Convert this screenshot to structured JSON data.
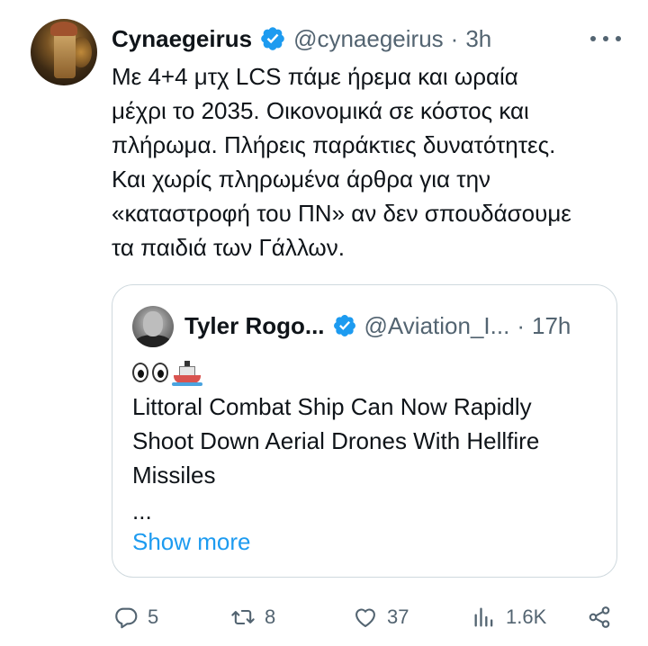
{
  "author": {
    "name": "Cynaegeirus",
    "handle": "@cynaegeirus",
    "separator": "·",
    "time": "3h",
    "verified_color": "#1d9bf0"
  },
  "tweet": {
    "lines": [
      "Με 4+4 μτχ LCS πάμε ήρεμα και ωραία",
      "μέχρι το 2035. Οικονομικά σε κόστος και",
      "πλήρωμα. Πλήρεις παράκτιες δυνατότητες.",
      "Και χωρίς πληρωμένα άρθρα για την",
      "«καταστροφή του ΠΝ» αν δεν σπουδάσουμε",
      "τα παιδιά των Γάλλων."
    ]
  },
  "quoted": {
    "name": "Tyler Rogo...",
    "handle": "@Aviation_I...",
    "separator": "·",
    "time": "17h",
    "emoji_icons": [
      "eyes-emoji",
      "ship-emoji"
    ],
    "lines": [
      "Littoral Combat Ship Can Now Rapidly",
      "Shoot Down Aerial Drones With Hellfire",
      "Missiles"
    ],
    "ellipsis": "...",
    "show_more": "Show more",
    "link_color": "#1d9bf0"
  },
  "actions": {
    "replies": "5",
    "retweets": "8",
    "likes": "37",
    "views": "1.6K",
    "icons": [
      "reply-icon",
      "retweet-icon",
      "like-icon",
      "views-icon",
      "share-icon"
    ],
    "muted_color": "#536471"
  }
}
